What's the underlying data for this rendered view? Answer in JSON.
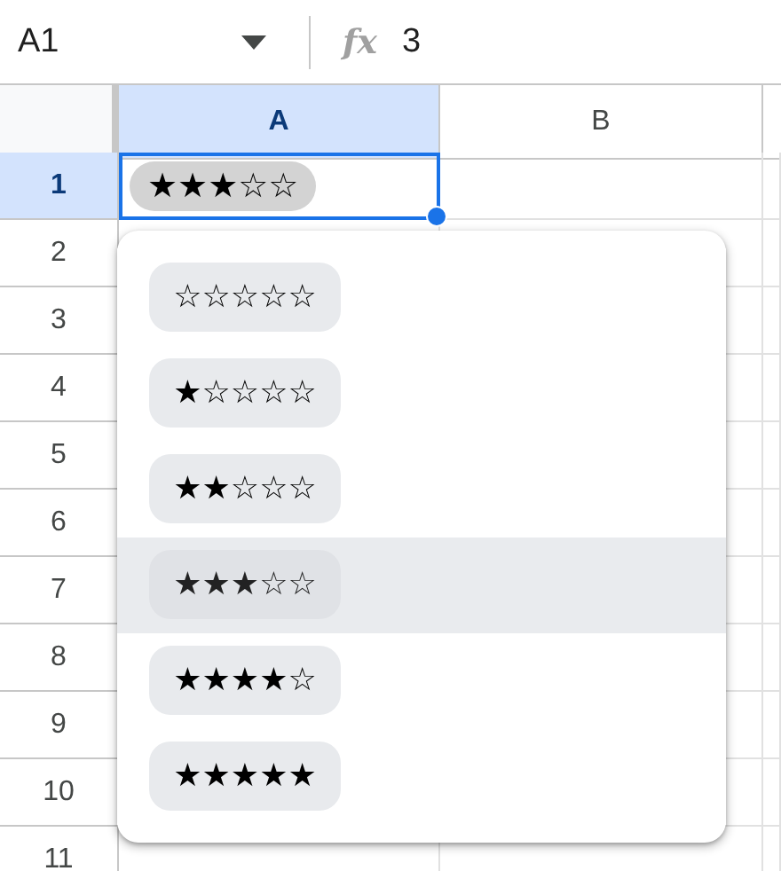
{
  "name_box": {
    "value": "A1"
  },
  "formula_bar": {
    "icon_text": "fx",
    "value": "3"
  },
  "columns": [
    {
      "label": "A",
      "selected": true
    },
    {
      "label": "B",
      "selected": false
    }
  ],
  "rows": [
    {
      "label": "1",
      "selected": true
    },
    {
      "label": "2",
      "selected": false
    },
    {
      "label": "3",
      "selected": false
    },
    {
      "label": "4",
      "selected": false
    },
    {
      "label": "5",
      "selected": false
    },
    {
      "label": "6",
      "selected": false
    },
    {
      "label": "7",
      "selected": false
    },
    {
      "label": "8",
      "selected": false
    },
    {
      "label": "9",
      "selected": false
    },
    {
      "label": "10",
      "selected": false
    },
    {
      "label": "11",
      "selected": false
    }
  ],
  "active_cell": {
    "value": "★★★☆☆"
  },
  "dropdown": {
    "options": [
      {
        "text": "☆☆☆☆☆",
        "selected": false
      },
      {
        "text": "★☆☆☆☆",
        "selected": false
      },
      {
        "text": "★★☆☆☆",
        "selected": false
      },
      {
        "text": "★★★☆☆",
        "selected": true
      },
      {
        "text": "★★★★☆",
        "selected": false
      },
      {
        "text": "★★★★★",
        "selected": false
      }
    ]
  }
}
